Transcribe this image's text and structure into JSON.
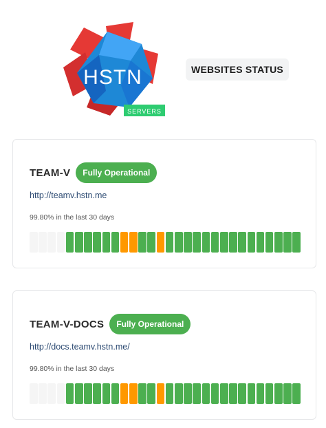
{
  "header": {
    "logo_text": "HSTN",
    "logo_tag": "SERVERS",
    "status_label": "WEBSITES STATUS"
  },
  "colors": {
    "operational": "#4caf50",
    "degraded": "#ff9800",
    "no_data": "#f5f5f5",
    "logo_red": "#e53935",
    "logo_blue": "#1e88d6"
  },
  "sites": [
    {
      "name": "TEAM-V",
      "status": "Fully Operational",
      "url": "http://teamv.hstn.me",
      "uptime_text": "99.80% in the last 30 days",
      "bars": [
        "empty",
        "empty",
        "empty",
        "empty",
        "ok",
        "ok",
        "ok",
        "ok",
        "ok",
        "ok",
        "warn",
        "warn",
        "ok",
        "ok",
        "warn",
        "ok",
        "ok",
        "ok",
        "ok",
        "ok",
        "ok",
        "ok",
        "ok",
        "ok",
        "ok",
        "ok",
        "ok",
        "ok",
        "ok",
        "ok"
      ]
    },
    {
      "name": "TEAM-V-DOCS",
      "status": "Fully Operational",
      "url": "http://docs.teamv.hstn.me/",
      "uptime_text": "99.80% in the last 30 days",
      "bars": [
        "empty",
        "empty",
        "empty",
        "empty",
        "ok",
        "ok",
        "ok",
        "ok",
        "ok",
        "ok",
        "warn",
        "warn",
        "ok",
        "ok",
        "warn",
        "ok",
        "ok",
        "ok",
        "ok",
        "ok",
        "ok",
        "ok",
        "ok",
        "ok",
        "ok",
        "ok",
        "ok",
        "ok",
        "ok",
        "ok"
      ]
    }
  ]
}
